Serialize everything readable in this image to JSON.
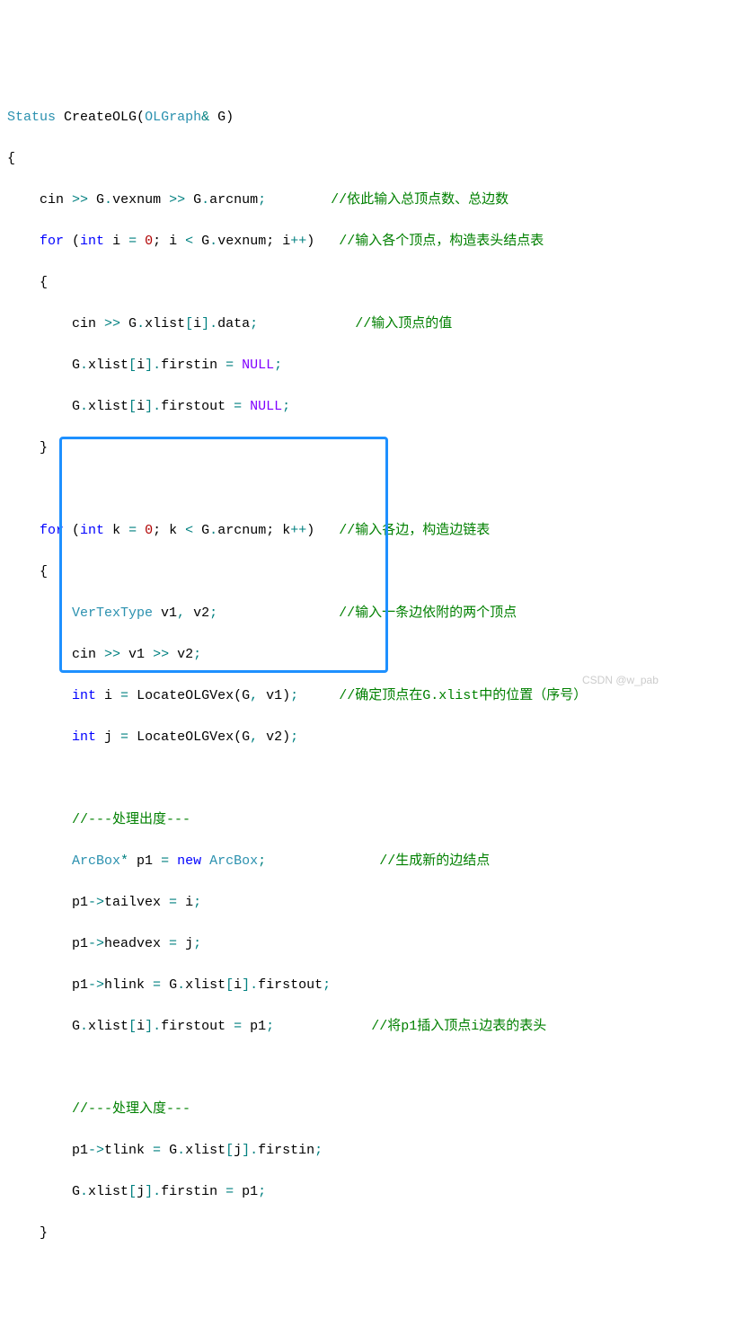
{
  "line1": {
    "a": "Status",
    "b": " ",
    "c": "CreateOLG",
    "d": "(",
    "e": "OLGraph",
    "f": "& ",
    "g": "G",
    "h": ")"
  },
  "line2": {
    "a": "{"
  },
  "line3": {
    "a": "    cin ",
    "b": ">>",
    "c": " G",
    "d": ".",
    "e": "vexnum ",
    "f": ">>",
    "g": " G",
    "h": ".",
    "i": "arcnum",
    "j": ";",
    "k": "        ",
    "l": "//依此输入总顶点数、总边数"
  },
  "line4": {
    "a": "    ",
    "b": "for",
    "c": " (",
    "d": "int",
    "e": " i ",
    "f": "=",
    "g": " ",
    "h": "0",
    "i": "; i ",
    "j": "<",
    "k": " G",
    "l": ".",
    "m": "vexnum",
    "n": "; i",
    "o": "++",
    "p": ")   ",
    "q": "//输入各个顶点，构造表头结点表"
  },
  "line5": {
    "a": "    {"
  },
  "line6": {
    "a": "        cin ",
    "b": ">>",
    "c": " G",
    "d": ".",
    "e": "xlist",
    "f": "[",
    "g": "i",
    "h": "].",
    "i": "data",
    "j": ";",
    "k": "            ",
    "l": "//输入顶点的值"
  },
  "line7": {
    "a": "        G",
    "b": ".",
    "c": "xlist",
    "d": "[",
    "e": "i",
    "f": "].",
    "g": "firstin ",
    "h": "=",
    "i": " ",
    "j": "NULL",
    "k": ";"
  },
  "line8": {
    "a": "        G",
    "b": ".",
    "c": "xlist",
    "d": "[",
    "e": "i",
    "f": "].",
    "g": "firstout ",
    "h": "=",
    "i": " ",
    "j": "NULL",
    "k": ";"
  },
  "line9": {
    "a": "    }"
  },
  "line10": {
    "a": ""
  },
  "line11": {
    "a": "    ",
    "b": "for",
    "c": " (",
    "d": "int",
    "e": " k ",
    "f": "=",
    "g": " ",
    "h": "0",
    "i": "; k ",
    "j": "<",
    "k": " G",
    "l": ".",
    "m": "arcnum",
    "n": "; k",
    "o": "++",
    "p": ")   ",
    "q": "//输入各边，构造边链表"
  },
  "line12": {
    "a": "    {"
  },
  "line13": {
    "a": "        ",
    "b": "VerTexType",
    "c": " v1",
    "d": ",",
    "e": " v2",
    "f": ";",
    "g": "               ",
    "h": "//输入一条边依附的两个顶点"
  },
  "line14": {
    "a": "        cin ",
    "b": ">>",
    "c": " v1 ",
    "d": ">>",
    "e": " v2",
    "f": ";"
  },
  "line15": {
    "a": "        ",
    "b": "int",
    "c": " i ",
    "d": "=",
    "e": " ",
    "f": "LocateOLGVex",
    "g": "(G",
    "h": ",",
    "i": " v1)",
    "j": ";",
    "k": "     ",
    "l": "//确定顶点在G.xlist中的位置（序号）"
  },
  "line16": {
    "a": "        ",
    "b": "int",
    "c": " j ",
    "d": "=",
    "e": " ",
    "f": "LocateOLGVex",
    "g": "(G",
    "h": ",",
    "i": " v2)",
    "j": ";"
  },
  "line17": {
    "a": ""
  },
  "line18": {
    "a": "        ",
    "b": "//---处理出度---"
  },
  "line19": {
    "a": "        ",
    "b": "ArcBox",
    "c": "*",
    "d": " p1 ",
    "e": "=",
    "f": " ",
    "g": "new",
    "h": " ",
    "i": "ArcBox",
    "j": ";",
    "k": "              ",
    "l": "//生成新的边结点"
  },
  "line20": {
    "a": "        p1",
    "b": "->",
    "c": "tailvex ",
    "d": "=",
    "e": " i",
    "f": ";"
  },
  "line21": {
    "a": "        p1",
    "b": "->",
    "c": "headvex ",
    "d": "=",
    "e": " j",
    "f": ";"
  },
  "line22": {
    "a": "        p1",
    "b": "->",
    "c": "hlink ",
    "d": "=",
    "e": " G",
    "f": ".",
    "g": "xlist",
    "h": "[",
    "i": "i",
    "j": "].",
    "k": "firstout",
    "l": ";"
  },
  "line23": {
    "a": "        G",
    "b": ".",
    "c": "xlist",
    "d": "[",
    "e": "i",
    "f": "].",
    "g": "firstout ",
    "h": "=",
    "i": " p1",
    "j": ";",
    "k": "            ",
    "l": "//将p1插入顶点i边表的表头"
  },
  "line24": {
    "a": ""
  },
  "line25": {
    "a": "        ",
    "b": "//---处理入度---"
  },
  "line26": {
    "a": "        p1",
    "b": "->",
    "c": "tlink ",
    "d": "=",
    "e": " G",
    "f": ".",
    "g": "xlist",
    "h": "[",
    "i": "j",
    "j": "].",
    "k": "firstin",
    "l": ";"
  },
  "line27": {
    "a": "        G",
    "b": ".",
    "c": "xlist",
    "d": "[",
    "e": "j",
    "f": "].",
    "g": "firstin ",
    "h": "=",
    "i": " p1",
    "j": ";"
  },
  "line28": {
    "a": "    }"
  },
  "watermark": "CSDN @w_pab"
}
